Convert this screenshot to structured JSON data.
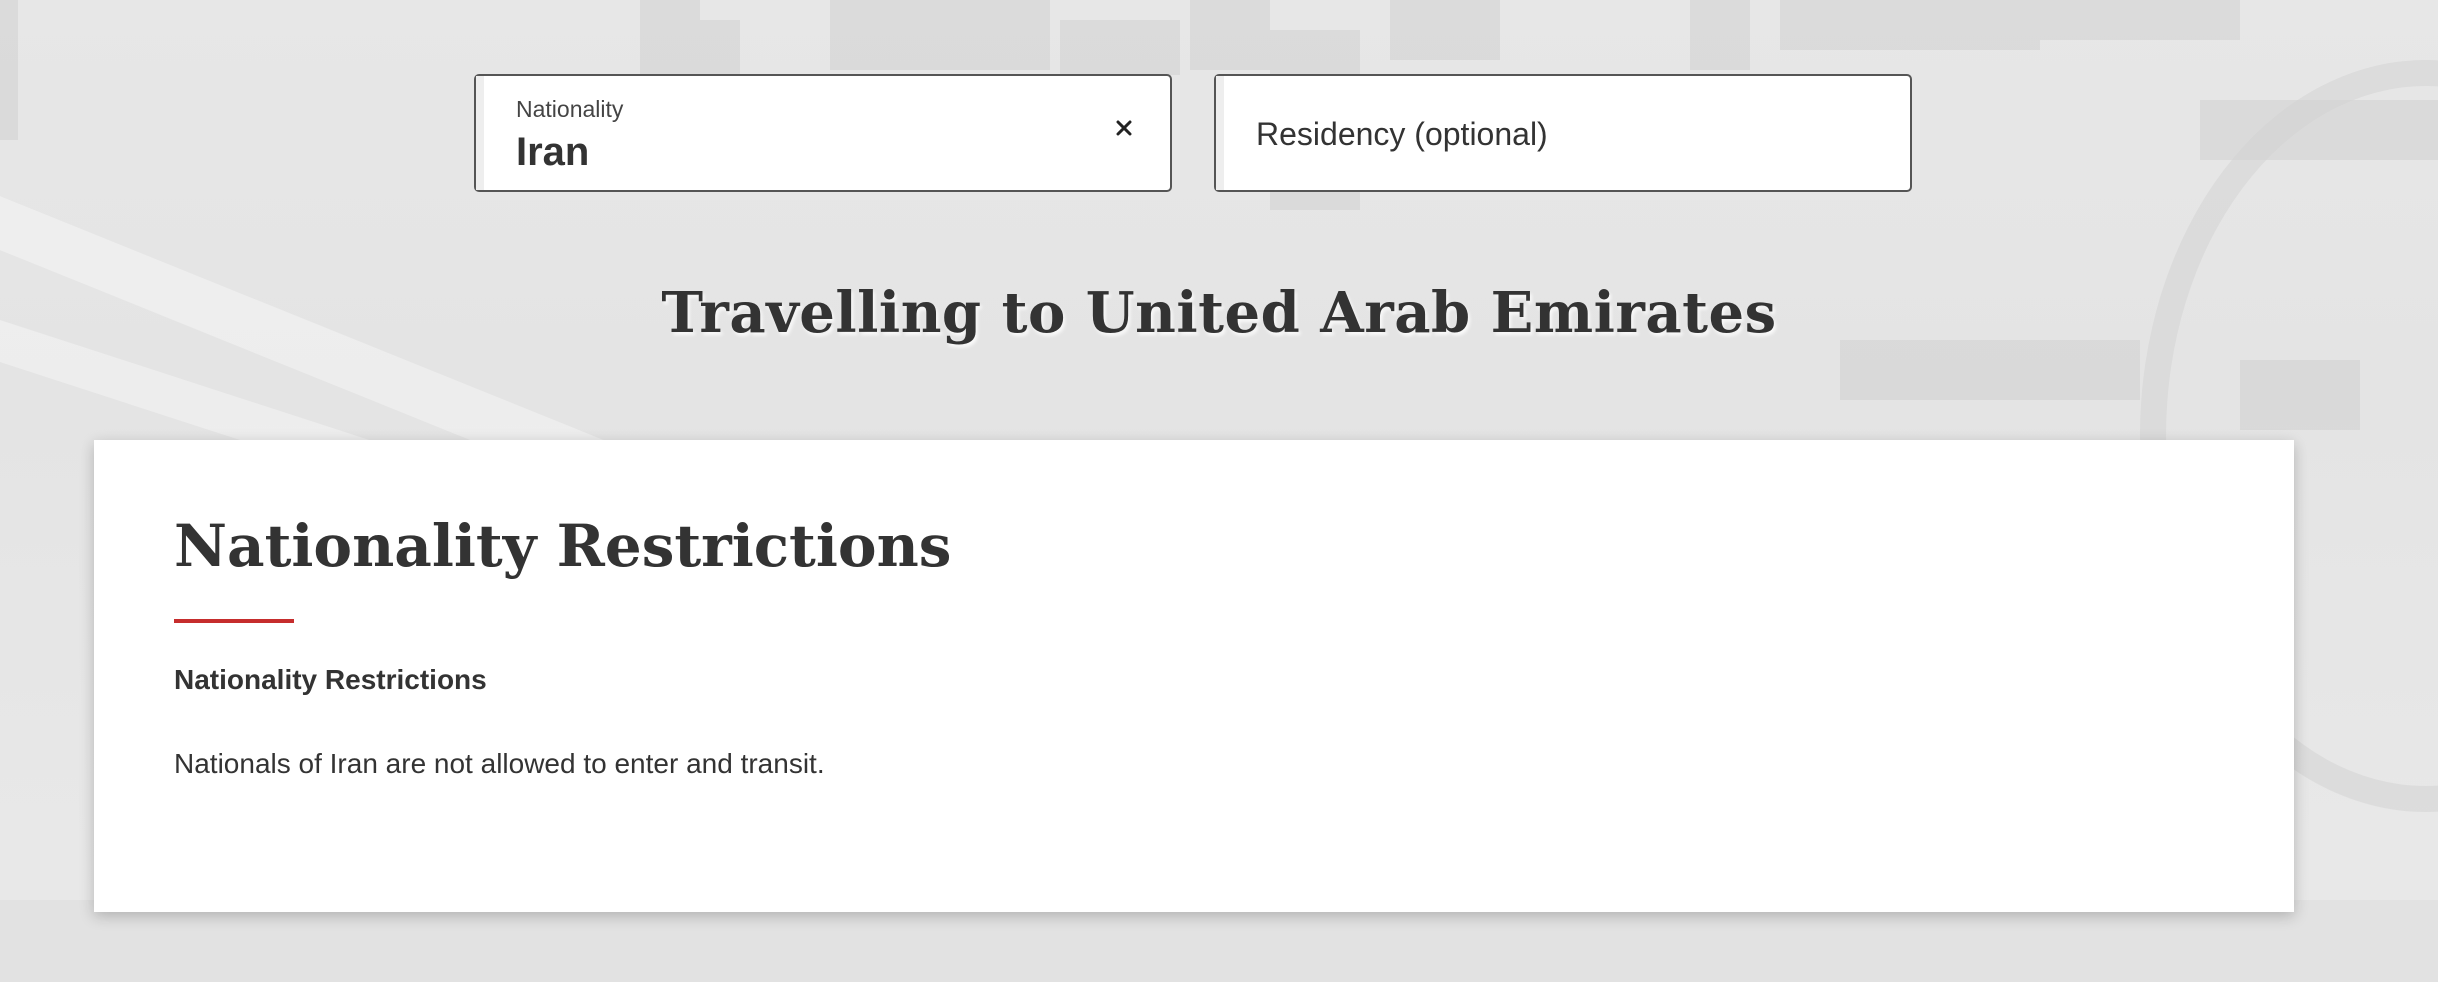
{
  "search": {
    "nationality": {
      "label": "Nationality",
      "value": "Iran"
    },
    "residency": {
      "placeholder": "Residency (optional)"
    },
    "clear_icon": "close-icon"
  },
  "destination": {
    "title": "Travelling to United Arab Emirates"
  },
  "card": {
    "title": "Nationality Restrictions",
    "subtitle": "Nationality Restrictions",
    "text": "Nationals of Iran are not allowed to enter and transit."
  },
  "colors": {
    "accent": "#c62d2d",
    "text": "#333333",
    "field_border": "#555555"
  }
}
